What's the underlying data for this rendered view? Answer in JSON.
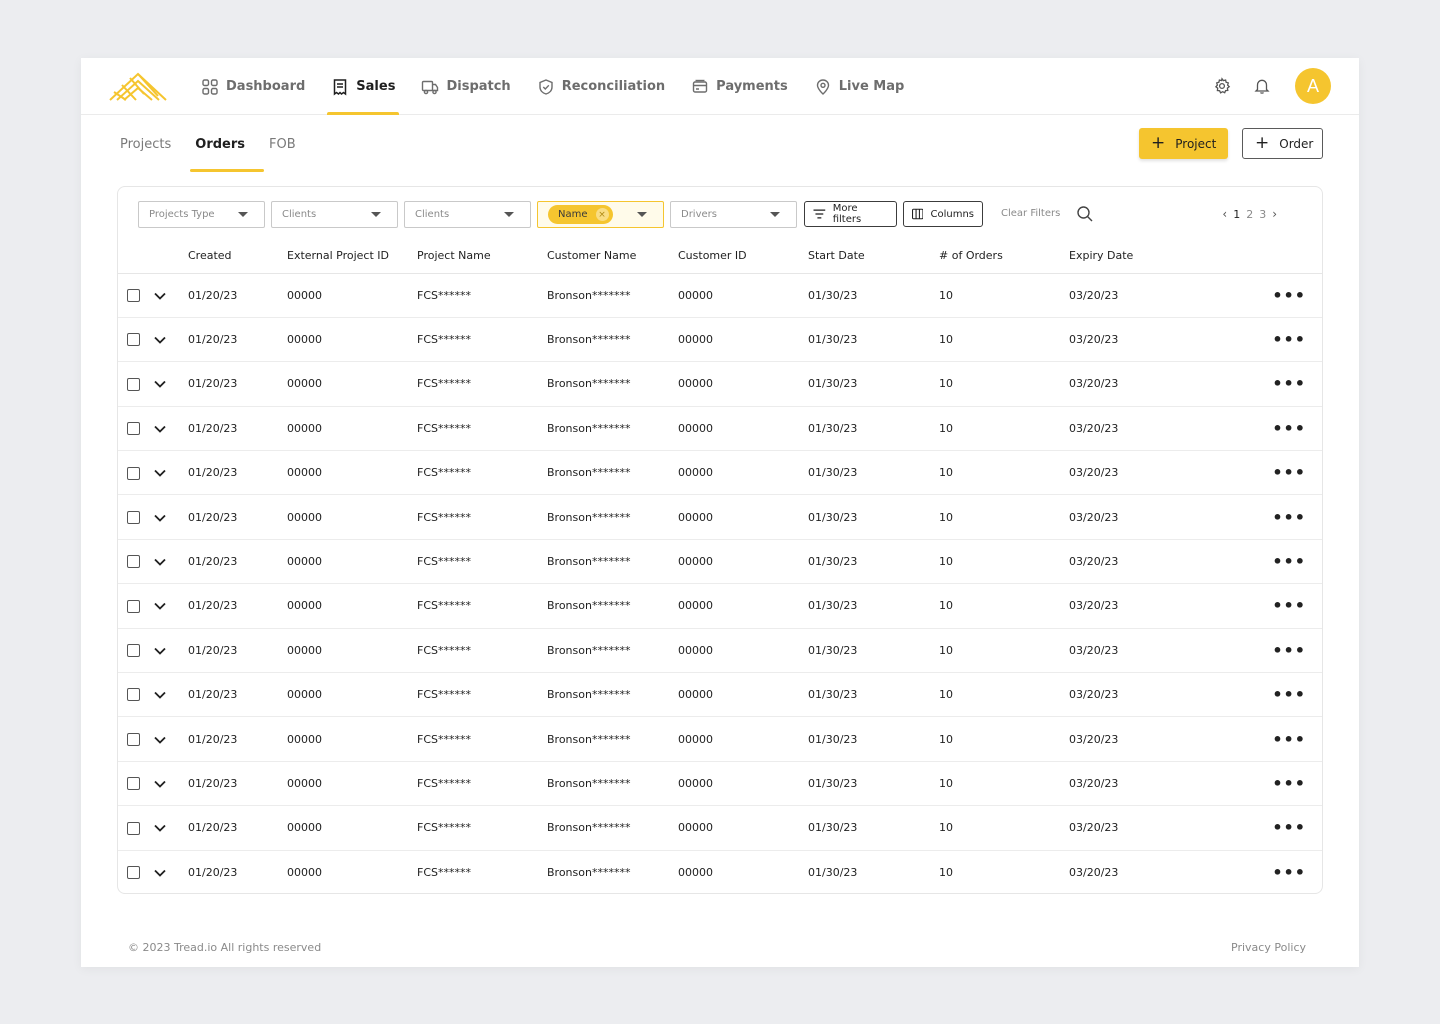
{
  "nav": {
    "items": [
      {
        "label": "Dashboard",
        "icon": "dashboard-icon",
        "active": false
      },
      {
        "label": "Sales",
        "icon": "receipt-icon",
        "active": true
      },
      {
        "label": "Dispatch",
        "icon": "truck-icon",
        "active": false
      },
      {
        "label": "Reconciliation",
        "icon": "shield-check-icon",
        "active": false
      },
      {
        "label": "Payments",
        "icon": "credit-card-icon",
        "active": false
      },
      {
        "label": "Live Map",
        "icon": "map-pin-icon",
        "active": false
      }
    ],
    "avatar_initial": "A"
  },
  "subtabs": [
    {
      "label": "Projects",
      "active": false
    },
    {
      "label": "Orders",
      "active": true
    },
    {
      "label": "FOB",
      "active": false
    }
  ],
  "actions": {
    "project_label": "Project",
    "order_label": "Order"
  },
  "filters": {
    "projects_type": "Projects Type",
    "clients_1": "Clients",
    "clients_2": "Clients",
    "name_chip": "Name",
    "drivers": "Drivers",
    "more_filters": "More filters",
    "columns": "Columns",
    "clear_filters": "Clear Filters"
  },
  "pager": {
    "pages": [
      "1",
      "2",
      "3"
    ],
    "current": "1"
  },
  "table": {
    "columns": [
      "Created",
      "External Project ID",
      "Project Name",
      "Customer Name",
      "Customer ID",
      "Start Date",
      "# of Orders",
      "Expiry Date"
    ],
    "rows": [
      [
        "01/20/23",
        "00000",
        "FCS******",
        "Bronson*******",
        "00000",
        "01/30/23",
        "10",
        "03/20/23"
      ],
      [
        "01/20/23",
        "00000",
        "FCS******",
        "Bronson*******",
        "00000",
        "01/30/23",
        "10",
        "03/20/23"
      ],
      [
        "01/20/23",
        "00000",
        "FCS******",
        "Bronson*******",
        "00000",
        "01/30/23",
        "10",
        "03/20/23"
      ],
      [
        "01/20/23",
        "00000",
        "FCS******",
        "Bronson*******",
        "00000",
        "01/30/23",
        "10",
        "03/20/23"
      ],
      [
        "01/20/23",
        "00000",
        "FCS******",
        "Bronson*******",
        "00000",
        "01/30/23",
        "10",
        "03/20/23"
      ],
      [
        "01/20/23",
        "00000",
        "FCS******",
        "Bronson*******",
        "00000",
        "01/30/23",
        "10",
        "03/20/23"
      ],
      [
        "01/20/23",
        "00000",
        "FCS******",
        "Bronson*******",
        "00000",
        "01/30/23",
        "10",
        "03/20/23"
      ],
      [
        "01/20/23",
        "00000",
        "FCS******",
        "Bronson*******",
        "00000",
        "01/30/23",
        "10",
        "03/20/23"
      ],
      [
        "01/20/23",
        "00000",
        "FCS******",
        "Bronson*******",
        "00000",
        "01/30/23",
        "10",
        "03/20/23"
      ],
      [
        "01/20/23",
        "00000",
        "FCS******",
        "Bronson*******",
        "00000",
        "01/30/23",
        "10",
        "03/20/23"
      ],
      [
        "01/20/23",
        "00000",
        "FCS******",
        "Bronson*******",
        "00000",
        "01/30/23",
        "10",
        "03/20/23"
      ],
      [
        "01/20/23",
        "00000",
        "FCS******",
        "Bronson*******",
        "00000",
        "01/30/23",
        "10",
        "03/20/23"
      ],
      [
        "01/20/23",
        "00000",
        "FCS******",
        "Bronson*******",
        "00000",
        "01/30/23",
        "10",
        "03/20/23"
      ],
      [
        "01/20/23",
        "00000",
        "FCS******",
        "Bronson*******",
        "00000",
        "01/30/23",
        "10",
        "03/20/23"
      ]
    ],
    "row_menu": "•••"
  },
  "footer": {
    "copyright": "© 2023 Tread.io All rights reserved",
    "privacy": "Privacy Policy"
  },
  "colors": {
    "accent": "#f5c52f"
  }
}
